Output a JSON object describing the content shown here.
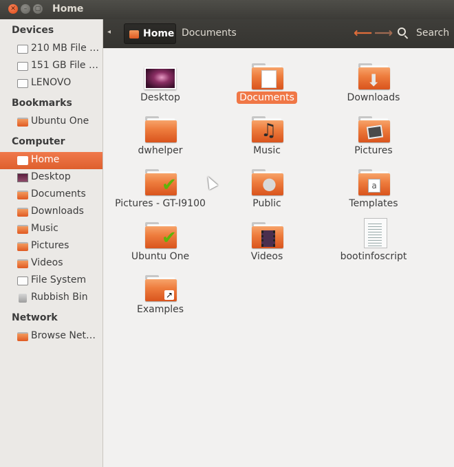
{
  "window": {
    "title": "Home"
  },
  "sidebar": {
    "sections": [
      {
        "heading": "Devices",
        "items": [
          {
            "label": "210 MB File …",
            "icon": "drive-icon"
          },
          {
            "label": "151 GB File s…",
            "icon": "drive-icon"
          },
          {
            "label": "LENOVO",
            "icon": "drive-icon"
          }
        ]
      },
      {
        "heading": "Bookmarks",
        "items": [
          {
            "label": "Ubuntu One",
            "icon": "folder-icon"
          }
        ]
      },
      {
        "heading": "Computer",
        "items": [
          {
            "label": "Home",
            "icon": "home-icon",
            "active": true
          },
          {
            "label": "Desktop",
            "icon": "desktop-icon"
          },
          {
            "label": "Documents",
            "icon": "folder-icon"
          },
          {
            "label": "Downloads",
            "icon": "folder-icon"
          },
          {
            "label": "Music",
            "icon": "folder-icon"
          },
          {
            "label": "Pictures",
            "icon": "folder-icon"
          },
          {
            "label": "Videos",
            "icon": "folder-icon"
          },
          {
            "label": "File System",
            "icon": "drive-icon"
          },
          {
            "label": "Rubbish Bin",
            "icon": "bin-icon"
          }
        ]
      },
      {
        "heading": "Network",
        "items": [
          {
            "label": "Browse Net…",
            "icon": "network-icon"
          }
        ]
      }
    ]
  },
  "toolbar": {
    "crumbs": [
      "Home",
      "Documents"
    ],
    "search_label": "Search"
  },
  "files": [
    {
      "name": "Desktop",
      "kind": "desktop"
    },
    {
      "name": "Documents",
      "kind": "folder-documents",
      "selected": true
    },
    {
      "name": "Downloads",
      "kind": "folder-downloads"
    },
    {
      "name": "dwhelper",
      "kind": "folder"
    },
    {
      "name": "Music",
      "kind": "folder-music"
    },
    {
      "name": "Pictures",
      "kind": "folder-pictures"
    },
    {
      "name": "Pictures - GT-I9100",
      "kind": "folder-synced"
    },
    {
      "name": "Public",
      "kind": "folder-public"
    },
    {
      "name": "Templates",
      "kind": "folder-templates"
    },
    {
      "name": "Ubuntu One",
      "kind": "folder-synced"
    },
    {
      "name": "Videos",
      "kind": "folder-videos"
    },
    {
      "name": "bootinfoscript",
      "kind": "text-file"
    },
    {
      "name": "Examples",
      "kind": "folder-link"
    }
  ],
  "colors": {
    "accent": "#f07746",
    "titlebar": "#3c3b37",
    "folder": "#ee7d3e"
  }
}
